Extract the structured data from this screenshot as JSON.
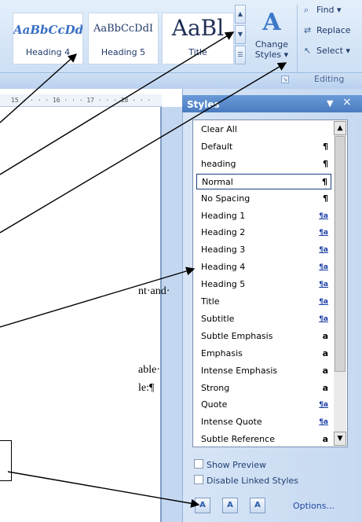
{
  "ribbon": {
    "gallery": [
      {
        "sample": "AaBbCcDd",
        "label": "Heading 4"
      },
      {
        "sample": "AaBbCcDdI",
        "label": "Heading 5"
      },
      {
        "sample": "AaBl",
        "label": "Title"
      }
    ],
    "change_styles": {
      "line1": "Change",
      "line2": "Styles ▾"
    },
    "editing": {
      "find": "Find ▾",
      "replace": "Replace",
      "select": "Select ▾",
      "group_label": "Editing"
    }
  },
  "ruler": {
    "text": "15 · · · · 16 · · · 17 · · · 18 · · ·"
  },
  "document": {
    "lines": [
      "nt·and·",
      "able·",
      "le:¶"
    ]
  },
  "styles_pane": {
    "title": "Styles",
    "dropdown": "▼",
    "close": "×",
    "items": [
      {
        "name": "Clear All",
        "mark": ""
      },
      {
        "name": "Default",
        "mark": "¶"
      },
      {
        "name": "heading",
        "mark": "¶"
      },
      {
        "name": "Normal",
        "mark": "¶"
      },
      {
        "name": "No Spacing",
        "mark": "¶"
      },
      {
        "name": "Heading 1",
        "mark": "¶a"
      },
      {
        "name": "Heading 2",
        "mark": "¶a"
      },
      {
        "name": "Heading 3",
        "mark": "¶a"
      },
      {
        "name": "Heading 4",
        "mark": "¶a"
      },
      {
        "name": "Heading 5",
        "mark": "¶a"
      },
      {
        "name": "Title",
        "mark": "¶a"
      },
      {
        "name": "Subtitle",
        "mark": "¶a"
      },
      {
        "name": "Subtle Emphasis",
        "mark": "a"
      },
      {
        "name": "Emphasis",
        "mark": "a"
      },
      {
        "name": "Intense Emphasis",
        "mark": "a"
      },
      {
        "name": "Strong",
        "mark": "a"
      },
      {
        "name": "Quote",
        "mark": "¶a"
      },
      {
        "name": "Intense Quote",
        "mark": "¶a"
      },
      {
        "name": "Subtle Reference",
        "mark": "a"
      }
    ],
    "show_preview": "Show Preview",
    "disable_linked": "Disable Linked Styles",
    "options": "Options...",
    "buttons": {
      "new_style": "A",
      "style_inspector": "A",
      "manage_styles": "A"
    }
  }
}
